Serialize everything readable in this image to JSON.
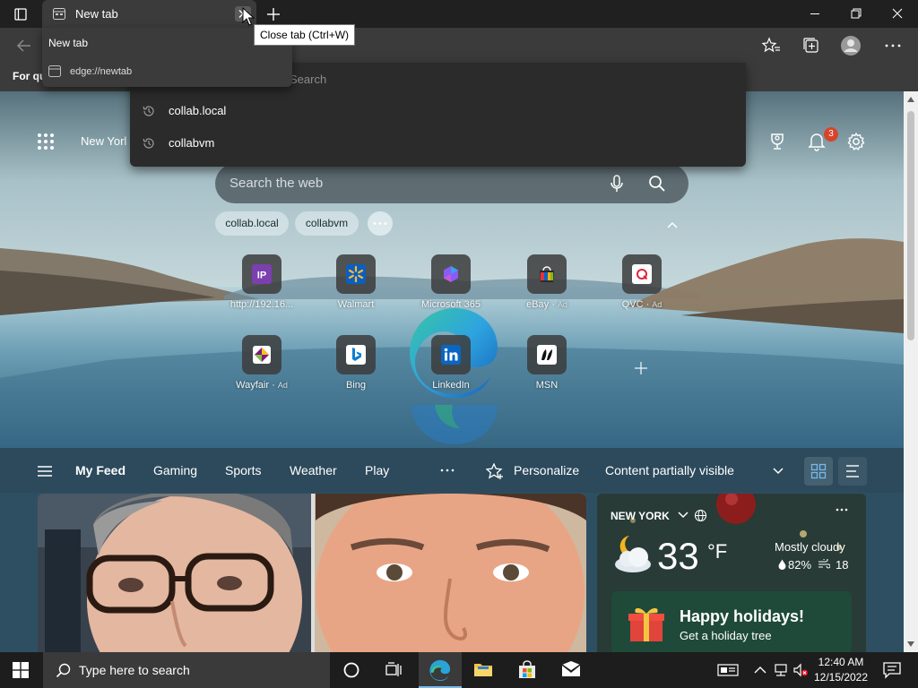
{
  "browser": {
    "tab_title": "New tab",
    "close_tooltip": "Close tab (Ctrl+W)",
    "hover_card": {
      "title": "New tab",
      "url": "edge://newtab"
    },
    "favorites_bar_label": "For qu",
    "omnibox_search_hint": "Search",
    "suggestions": [
      "collab.local",
      "collabvm"
    ]
  },
  "ntp": {
    "location": "New Yorl",
    "notification_count": "3",
    "search_placeholder": "Search the web",
    "chips": [
      "collab.local",
      "collabvm"
    ],
    "quick_links": [
      {
        "label": "http://192.16...",
        "ad": "",
        "icon": "ip-icon"
      },
      {
        "label": "Walmart",
        "ad": "",
        "icon": "walmart-icon"
      },
      {
        "label": "Microsoft 365",
        "ad": "",
        "icon": "microsoft-365-icon"
      },
      {
        "label": "eBay",
        "ad": "Ad",
        "icon": "ebay-icon"
      },
      {
        "label": "QVC",
        "ad": "Ad",
        "icon": "qvc-icon"
      },
      {
        "label": "Wayfair",
        "ad": "Ad",
        "icon": "wayfair-icon"
      },
      {
        "label": "Bing",
        "ad": "",
        "icon": "bing-icon"
      },
      {
        "label": "LinkedIn",
        "ad": "",
        "icon": "linkedin-icon"
      },
      {
        "label": "MSN",
        "ad": "",
        "icon": "msn-icon"
      }
    ]
  },
  "feed": {
    "nav": [
      "My Feed",
      "Gaming",
      "Sports",
      "Weather",
      "Play"
    ],
    "personalize": "Personalize",
    "content_visibility": "Content partially visible"
  },
  "weather": {
    "city": "NEW YORK",
    "temp": "33",
    "unit": "°F",
    "condition": "Mostly cloudy",
    "humidity": "82%",
    "aqi": "18",
    "promo_title": "Happy holidays!",
    "promo_subtitle": "Get a holiday tree"
  },
  "taskbar": {
    "search_placeholder": "Type here to search",
    "time": "12:40 AM",
    "date": "12/15/2022"
  },
  "colors": {
    "accent": "#76b9ed",
    "badge": "#d8442a"
  }
}
